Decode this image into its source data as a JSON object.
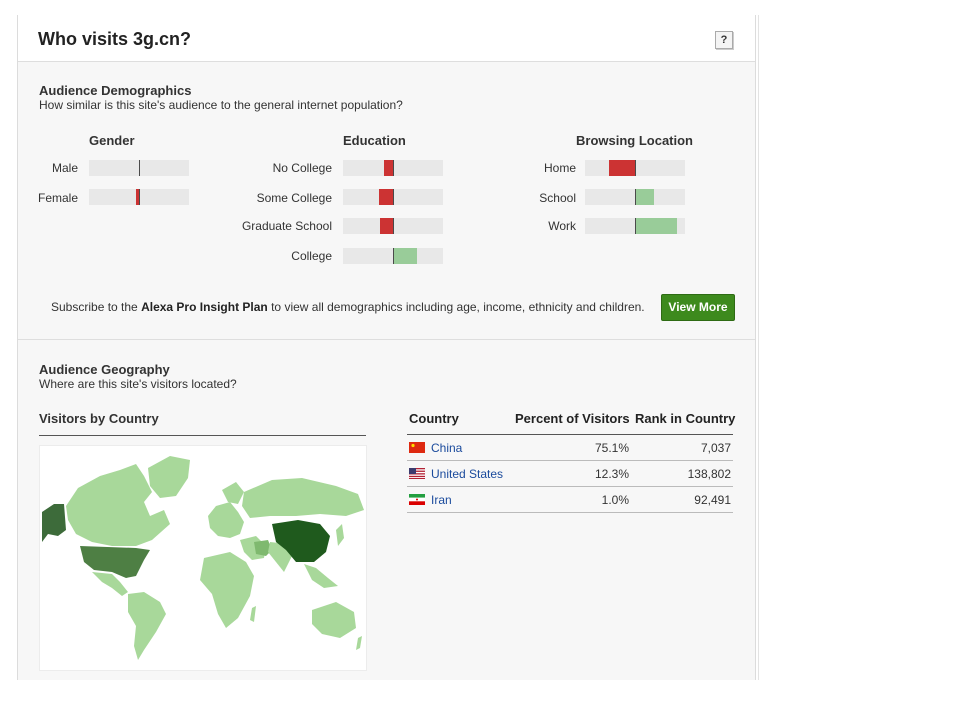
{
  "header": {
    "title": "Who visits 3g.cn?",
    "help_label": "?"
  },
  "demographics": {
    "title": "Audience Demographics",
    "subtitle": "How similar is this site's audience to the general internet population?",
    "groups": [
      {
        "heading": "Gender",
        "rows": [
          {
            "label": "Male",
            "value": 0.02
          },
          {
            "label": "Female",
            "value": -0.06
          }
        ]
      },
      {
        "heading": "Education",
        "rows": [
          {
            "label": "No College",
            "value": -0.18
          },
          {
            "label": "Some College",
            "value": -0.28
          },
          {
            "label": "Graduate School",
            "value": -0.26
          },
          {
            "label": "College",
            "value": 0.48
          }
        ]
      },
      {
        "heading": "Browsing Location",
        "rows": [
          {
            "label": "Home",
            "value": -0.52
          },
          {
            "label": "School",
            "value": 0.38
          },
          {
            "label": "Work",
            "value": 0.84
          }
        ]
      }
    ],
    "subscribe_prefix": "Subscribe to the ",
    "subscribe_plan": "Alexa Pro Insight Plan",
    "subscribe_suffix": " to view all demographics including age, income, ethnicity and children.",
    "view_more_label": "View More",
    "colors": {
      "below": "#cc3333",
      "above": "#99cc99",
      "button": "#3d8a1d"
    }
  },
  "geography": {
    "title": "Audience Geography",
    "subtitle": "Where are this site's visitors located?",
    "map_title": "Visitors by Country",
    "table": {
      "headers": [
        "Country",
        "Percent of Visitors",
        "Rank in Country"
      ],
      "rows": [
        {
          "flag": "china-flag-icon",
          "country": "China",
          "percent": "75.1%",
          "rank": "7,037"
        },
        {
          "flag": "us-flag-icon",
          "country": "United States",
          "percent": "12.3%",
          "rank": "138,802"
        },
        {
          "flag": "iran-flag-icon",
          "country": "Iran",
          "percent": "1.0%",
          "rank": "92,491"
        }
      ]
    }
  }
}
